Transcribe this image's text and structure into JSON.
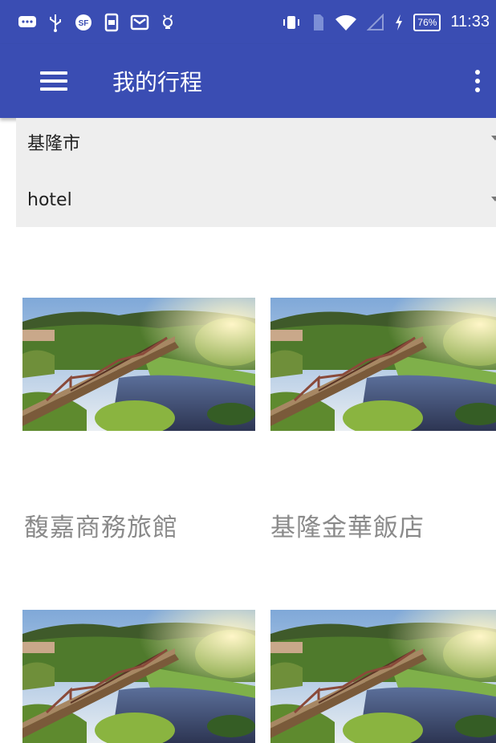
{
  "status_bar": {
    "time": "11:33",
    "battery_percent": "76%",
    "icons": [
      "message-icon",
      "usb-icon",
      "sf-app-icon",
      "sim-manager-icon",
      "mail-icon",
      "lightbulb-icon",
      "vibrate-icon",
      "sim-icon",
      "wifi-icon",
      "signal-icon",
      "charging-icon",
      "battery-icon"
    ]
  },
  "app_bar": {
    "title": "我的行程",
    "menu_icon": "hamburger-menu-icon",
    "overflow_icon": "more-vert-icon"
  },
  "filters": {
    "city": "基隆市",
    "category": "hotel"
  },
  "hotels": [
    {
      "name": "馥嘉商務旅館",
      "image": "bridge-landscape-photo"
    },
    {
      "name": "基隆金華飯店",
      "image": "bridge-landscape-photo"
    },
    {
      "name": "",
      "image": "bridge-landscape-photo"
    },
    {
      "name": "",
      "image": "bridge-landscape-photo"
    }
  ],
  "colors": {
    "primary": "#3a4db3",
    "filter_background": "#eeeeee",
    "hotel_name_text": "#8a8a8a"
  }
}
